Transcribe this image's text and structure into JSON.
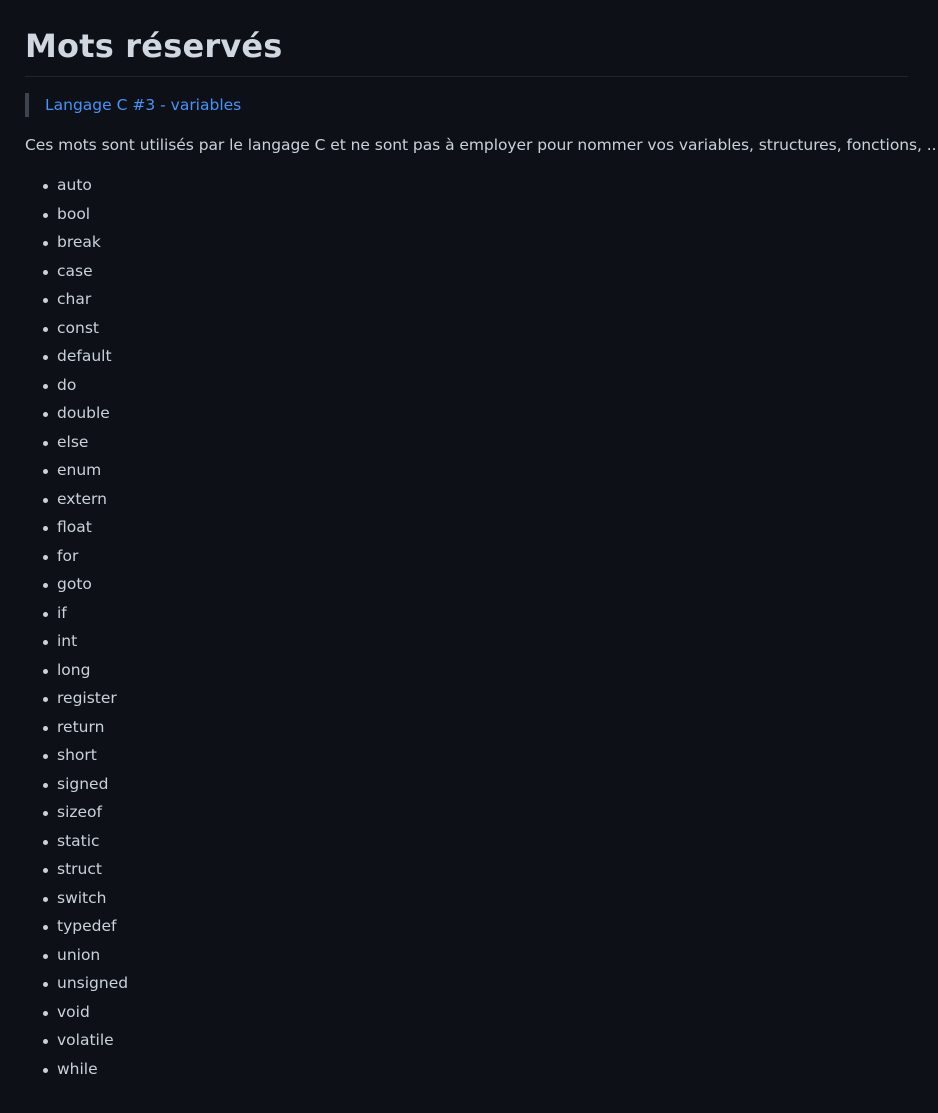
{
  "heading": "Mots réservés",
  "quote_link": "Langage C #3 - variables",
  "intro": "Ces mots sont utilisés par le langage C et ne sont pas à employer pour nommer vos variables, structures, fonctions, ...",
  "keywords": [
    "auto",
    "bool",
    "break",
    "case",
    "char",
    "const",
    "default",
    "do",
    "double",
    "else",
    "enum",
    "extern",
    "float",
    "for",
    "goto",
    "if",
    "int",
    "long",
    "register",
    "return",
    "short",
    "signed",
    "sizeof",
    "static",
    "struct",
    "switch",
    "typedef",
    "union",
    "unsigned",
    "void",
    "volatile",
    "while"
  ],
  "colors": {
    "background": "#0d1117",
    "text": "#c9d1d9",
    "link": "#4493f8",
    "quote_border": "#3d444d"
  }
}
